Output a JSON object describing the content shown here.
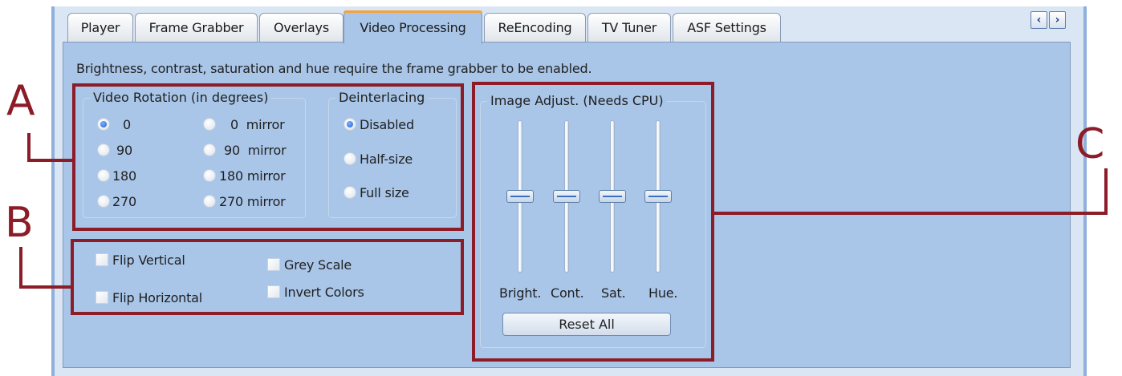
{
  "tabs": [
    {
      "label": "Player"
    },
    {
      "label": "Frame Grabber"
    },
    {
      "label": "Overlays"
    },
    {
      "label": "Video Processing",
      "active": true
    },
    {
      "label": "ReEncoding"
    },
    {
      "label": "TV Tuner"
    },
    {
      "label": "ASF Settings"
    }
  ],
  "tab_scroll": {
    "left_icon": "chevron-left-icon",
    "right_icon": "chevron-right-icon"
  },
  "notice": "Brightness, contrast, saturation and hue require the frame grabber to be enabled.",
  "video_rotation": {
    "legend": "Video Rotation (in degrees)",
    "options": [
      "0",
      "90",
      "180",
      "270",
      "0  mirror",
      "90  mirror",
      "180 mirror",
      "270 mirror"
    ],
    "selected": "0"
  },
  "deinterlacing": {
    "legend": "Deinterlacing",
    "options": [
      "Disabled",
      "Half-size",
      "Full size"
    ],
    "selected": "Disabled"
  },
  "flip": {
    "flip_vertical": "Flip Vertical",
    "flip_horizontal": "Flip Horizontal",
    "grey_scale": "Grey Scale",
    "invert_colors": "Invert Colors"
  },
  "image_adjust": {
    "legend": "Image Adjust. (Needs CPU)",
    "sliders": [
      {
        "label": "Bright.",
        "level": 0.5
      },
      {
        "label": "Cont.",
        "level": 0.5
      },
      {
        "label": "Sat.",
        "level": 0.5
      },
      {
        "label": "Hue.",
        "level": 0.5
      }
    ],
    "reset_label": "Reset All"
  },
  "annotations": {
    "a": "A",
    "b": "B",
    "c": "C"
  },
  "colors": {
    "annotation": "#8c1c28",
    "panel": "#a9c6e9",
    "active_tab_accent": "#f3a33c",
    "radio_selected": "#1e5fd6"
  }
}
